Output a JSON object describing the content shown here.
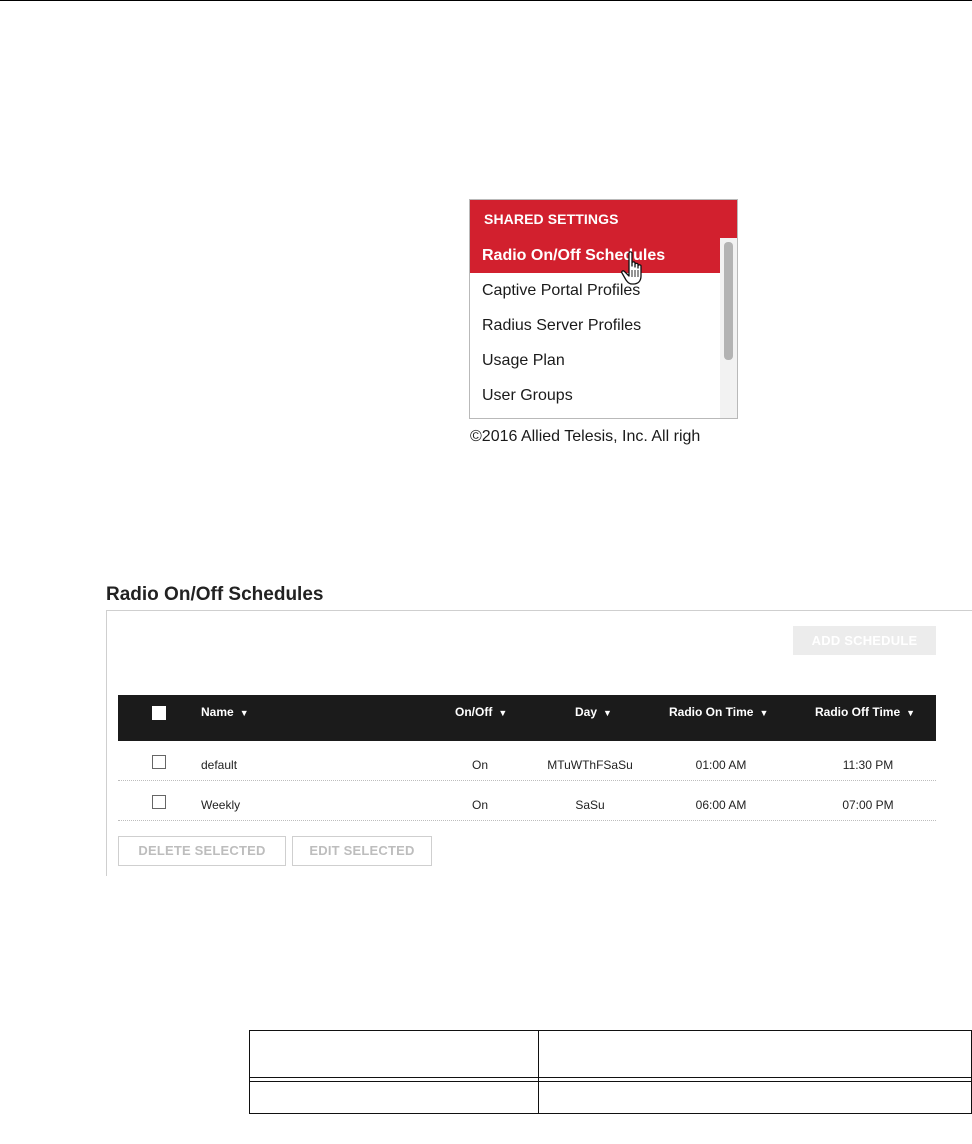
{
  "menu": {
    "header": "SHARED SETTINGS",
    "items": [
      {
        "label": "Radio On/Off Schedules",
        "active": true
      },
      {
        "label": "Captive Portal Profiles",
        "active": false
      },
      {
        "label": "Radius Server Profiles",
        "active": false
      },
      {
        "label": "Usage Plan",
        "active": false
      },
      {
        "label": "User Groups",
        "active": false
      }
    ],
    "cursor_icon": "hand-pointer-icon"
  },
  "copyright": "©2016 Allied Telesis, Inc. All righ",
  "panel": {
    "title": "Radio On/Off Schedules",
    "add_button": "ADD SCHEDULE",
    "columns": [
      "Name",
      "On/Off",
      "Day",
      "Radio On Time",
      "Radio Off Time"
    ],
    "sort_arrow": "▼",
    "rows": [
      {
        "name": "default",
        "onoff": "On",
        "day": "MTuWThFSaSu",
        "on_time": "01:00 AM",
        "off_time": "11:30 PM"
      },
      {
        "name": "Weekly",
        "onoff": "On",
        "day": "SaSu",
        "on_time": "06:00 AM",
        "off_time": "07:00 PM"
      }
    ],
    "delete_button": "DELETE SELECTED",
    "edit_button": "EDIT SELECTED"
  },
  "colors": {
    "brand_red": "#d2202e",
    "header_dark": "#1b1b1b"
  }
}
